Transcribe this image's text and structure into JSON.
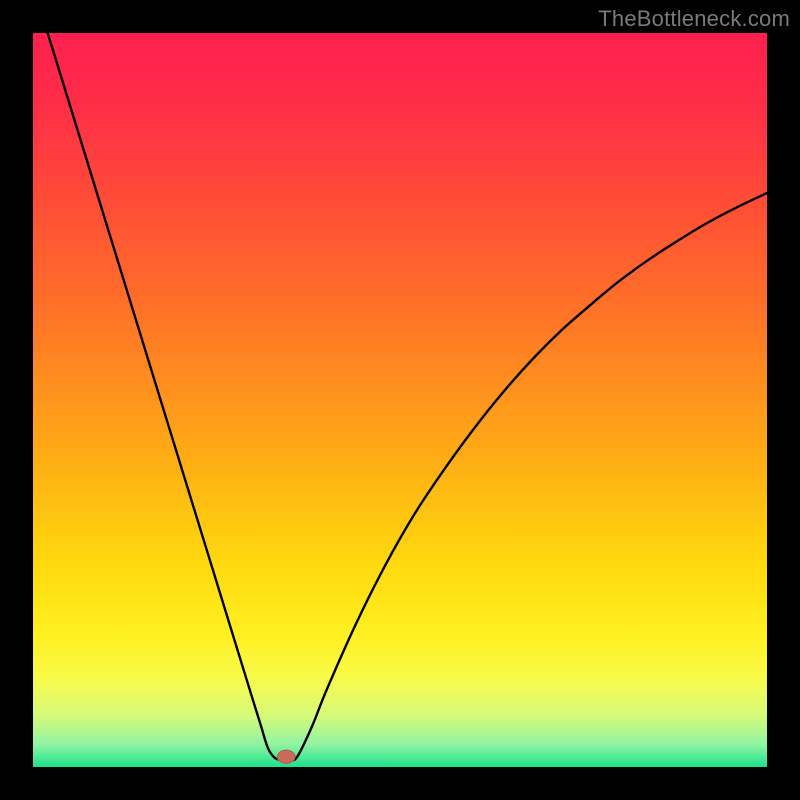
{
  "watermark": "TheBottleneck.com",
  "colors": {
    "frame": "#000000",
    "curve": "#000000",
    "marker_fill": "#c96a5a",
    "marker_stroke": "#b85a4c"
  },
  "gradient_stops": [
    {
      "offset": 0.0,
      "color": "#ff1f4f"
    },
    {
      "offset": 0.1,
      "color": "#ff2e47"
    },
    {
      "offset": 0.22,
      "color": "#ff4a38"
    },
    {
      "offset": 0.35,
      "color": "#ff6a2a"
    },
    {
      "offset": 0.48,
      "color": "#ff8f1e"
    },
    {
      "offset": 0.6,
      "color": "#ffb313"
    },
    {
      "offset": 0.72,
      "color": "#ffd80e"
    },
    {
      "offset": 0.82,
      "color": "#fff021"
    },
    {
      "offset": 0.88,
      "color": "#f8fb4b"
    },
    {
      "offset": 0.93,
      "color": "#d6fa7a"
    },
    {
      "offset": 0.97,
      "color": "#8ef3a3"
    },
    {
      "offset": 1.0,
      "color": "#19e38a"
    }
  ],
  "chart_data": {
    "type": "line",
    "title": "",
    "xlabel": "",
    "ylabel": "",
    "xlim": [
      0,
      100
    ],
    "ylim": [
      0,
      100
    ],
    "grid": false,
    "series": [
      {
        "name": "curve",
        "x": [
          2,
          4,
          6,
          8,
          10,
          12,
          14,
          16,
          18,
          20,
          22,
          24,
          26,
          28,
          30,
          31,
          32,
          33,
          34,
          35,
          36,
          38,
          40,
          44,
          48,
          52,
          56,
          60,
          64,
          68,
          72,
          76,
          80,
          84,
          88,
          92,
          96,
          100
        ],
        "y": [
          100,
          93.5,
          87,
          80.5,
          74,
          67.5,
          61,
          54.5,
          48,
          41.5,
          35,
          28.5,
          22,
          15.5,
          9,
          5.8,
          2.6,
          1.2,
          1.0,
          1.0,
          1.4,
          5.5,
          10.5,
          19.5,
          27.5,
          34.5,
          40.5,
          46,
          51,
          55.5,
          59.5,
          63,
          66.3,
          69.2,
          71.8,
          74.2,
          76.3,
          78.2
        ]
      }
    ],
    "marker": {
      "x": 34.5,
      "y": 1.4,
      "rx": 1.2,
      "ry": 0.9
    }
  }
}
